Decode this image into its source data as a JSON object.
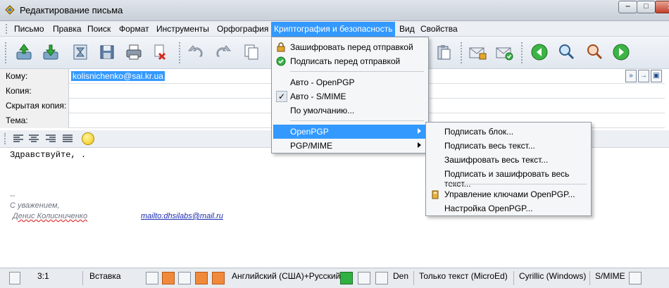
{
  "window": {
    "title": "Редактирование письма"
  },
  "menubar": {
    "items": [
      "Письмо",
      "Правка",
      "Поиск",
      "Формат",
      "Инструменты",
      "Орфография",
      "Криптография и безопасность",
      "Вид",
      "Свойства"
    ],
    "active_index": 6
  },
  "toolbar": {
    "buttons": [
      "send-icon",
      "receive-icon",
      "address-book-icon",
      "save-icon",
      "print-icon",
      "delete-icon",
      "undo-icon",
      "redo-icon",
      "copy-icon",
      "paste-icon",
      "encrypt-mail-icon",
      "signed-mail-icon",
      "back-icon",
      "find-icon",
      "find-next-icon",
      "forward-icon"
    ]
  },
  "headers": {
    "to_label": "Кому:",
    "to_value": "kolisnichenko@sai.kr.ua",
    "cc_label": "Копия:",
    "bcc_label": "Скрытая копия:",
    "subject_label": "Тема:"
  },
  "body": {
    "greeting": "Здравствуйте, .",
    "sig_separator": "--",
    "sig_regards": "С уважением,",
    "sig_name": "Денис Колисниченко",
    "sig_mailto": "mailto:dhsilabs@mail.ru"
  },
  "crypto_menu": {
    "items": [
      {
        "label": "Зашифровать перед отправкой",
        "icon": "lock-icon"
      },
      {
        "label": "Подписать перед отправкой",
        "icon": "check-circle-icon"
      },
      {
        "label": "Авто - OpenPGP"
      },
      {
        "label": "Авто - S/MIME",
        "checked": true
      },
      {
        "label": "По умолчанию..."
      },
      {
        "label": "OpenPGP",
        "submenu": true,
        "highlighted": true
      },
      {
        "label": "PGP/MIME",
        "submenu": true
      }
    ]
  },
  "openpgp_submenu": {
    "items": [
      {
        "label": "Подписать блок..."
      },
      {
        "label": "Подписать весь текст..."
      },
      {
        "label": "Зашифровать весь текст..."
      },
      {
        "label": "Подписать и зашифровать весь текст..."
      },
      {
        "label": "Управление ключами OpenPGP...",
        "icon": "key-icon"
      },
      {
        "label": "Настройка OpenPGP..."
      }
    ]
  },
  "statusbar": {
    "position": "3:1",
    "mode": "Вставка",
    "language": "Английский (США)+Русский",
    "dict": "Den",
    "format": "Только текст (MicroEd)",
    "encoding": "Cyrillic (Windows)",
    "security": "S/MIME"
  }
}
